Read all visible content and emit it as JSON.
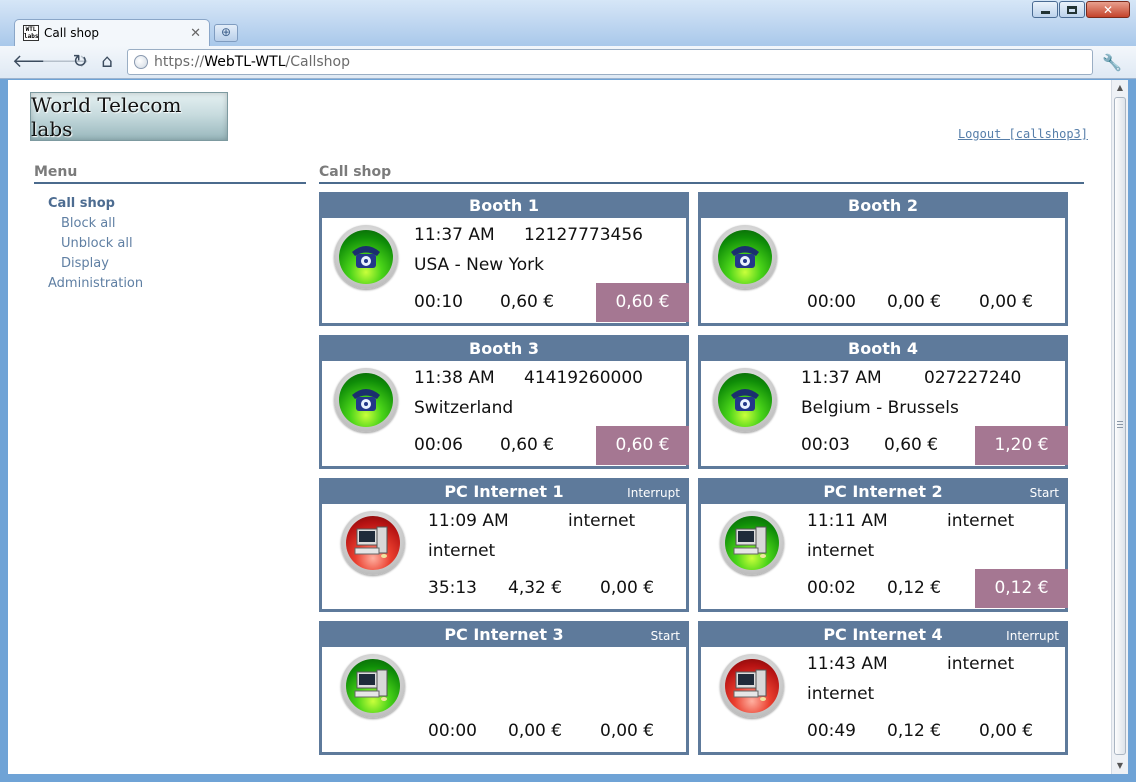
{
  "browser": {
    "tab_title": "Call shop",
    "tab_favicon_text": "WTL labs",
    "url_protocol": "https://",
    "url_host": "WebTL-WTL",
    "url_path": "/Callshop"
  },
  "header": {
    "logo_text": "World Telecom labs",
    "logout_label": "Logout [callshop3]"
  },
  "menu": {
    "title": "Menu",
    "items": [
      {
        "label": "Call shop"
      },
      {
        "label": "Block all"
      },
      {
        "label": "Unblock all"
      },
      {
        "label": "Display"
      },
      {
        "label": "Administration"
      }
    ]
  },
  "main": {
    "title": "Call shop",
    "booths": [
      {
        "name": "Booth 1",
        "action": "",
        "icon": "phone-icon",
        "status_color": "#2fb818",
        "time": "11:37 AM",
        "number": "12127773456",
        "destination": "USA - New York",
        "duration": "00:10",
        "cost": "0,60 €",
        "total": "0,60 €",
        "total_highlighted": true
      },
      {
        "name": "Booth 2",
        "action": "",
        "icon": "phone-icon",
        "status_color": "#2fb818",
        "time": "",
        "number": "",
        "destination": "",
        "duration": "00:00",
        "cost": "0,00 €",
        "total": "0,00 €",
        "total_highlighted": false
      },
      {
        "name": "Booth 3",
        "action": "",
        "icon": "phone-icon",
        "status_color": "#2fb818",
        "time": "11:38 AM",
        "number": "41419260000",
        "destination": "Switzerland",
        "duration": "00:06",
        "cost": "0,60 €",
        "total": "0,60 €",
        "total_highlighted": true
      },
      {
        "name": "Booth 4",
        "action": "",
        "icon": "phone-icon",
        "status_color": "#2fb818",
        "time": "11:37 AM",
        "number": "027227240",
        "destination": "Belgium - Brussels",
        "duration": "00:03",
        "cost": "0,60 €",
        "total": "1,20 €",
        "total_highlighted": true
      },
      {
        "name": "PC Internet 1",
        "action": "Interrupt",
        "icon": "computer-icon",
        "status_color": "#d42a1f",
        "time": "11:09 AM",
        "number": "internet",
        "destination": "internet",
        "duration": "35:13",
        "cost": "4,32 €",
        "total": "0,00 €",
        "total_highlighted": false
      },
      {
        "name": "PC Internet 2",
        "action": "Start",
        "icon": "computer-icon",
        "status_color": "#2fb818",
        "time": "11:11 AM",
        "number": "internet",
        "destination": "internet",
        "duration": "00:02",
        "cost": "0,12 €",
        "total": "0,12 €",
        "total_highlighted": true
      },
      {
        "name": "PC Internet 3",
        "action": "Start",
        "icon": "computer-icon",
        "status_color": "#2fb818",
        "time": "",
        "number": "",
        "destination": "",
        "duration": "00:00",
        "cost": "0,00 €",
        "total": "0,00 €",
        "total_highlighted": false
      },
      {
        "name": "PC Internet 4",
        "action": "Interrupt",
        "icon": "computer-icon",
        "status_color": "#d42a1f",
        "time": "11:43 AM",
        "number": "internet",
        "destination": "internet",
        "duration": "00:49",
        "cost": "0,12 €",
        "total": "0,00 €",
        "total_highlighted": false
      }
    ],
    "colors": {
      "card_border": "#5e7a9b",
      "total_highlight": "#a57792"
    }
  }
}
